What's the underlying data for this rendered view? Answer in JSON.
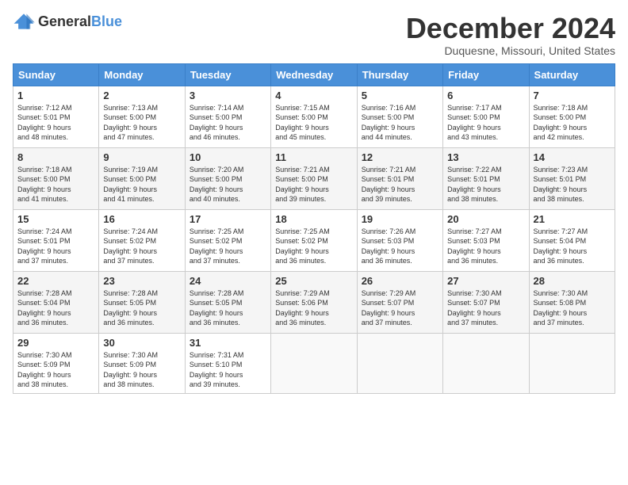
{
  "header": {
    "logo_general": "General",
    "logo_blue": "Blue",
    "month_title": "December 2024",
    "location": "Duquesne, Missouri, United States"
  },
  "weekdays": [
    "Sunday",
    "Monday",
    "Tuesday",
    "Wednesday",
    "Thursday",
    "Friday",
    "Saturday"
  ],
  "weeks": [
    [
      {
        "day": "1",
        "sunrise": "7:12 AM",
        "sunset": "5:01 PM",
        "daylight_hours": "9 hours",
        "daylight_mins": "48 minutes"
      },
      {
        "day": "2",
        "sunrise": "7:13 AM",
        "sunset": "5:00 PM",
        "daylight_hours": "9 hours",
        "daylight_mins": "47 minutes"
      },
      {
        "day": "3",
        "sunrise": "7:14 AM",
        "sunset": "5:00 PM",
        "daylight_hours": "9 hours",
        "daylight_mins": "46 minutes"
      },
      {
        "day": "4",
        "sunrise": "7:15 AM",
        "sunset": "5:00 PM",
        "daylight_hours": "9 hours",
        "daylight_mins": "45 minutes"
      },
      {
        "day": "5",
        "sunrise": "7:16 AM",
        "sunset": "5:00 PM",
        "daylight_hours": "9 hours",
        "daylight_mins": "44 minutes"
      },
      {
        "day": "6",
        "sunrise": "7:17 AM",
        "sunset": "5:00 PM",
        "daylight_hours": "9 hours",
        "daylight_mins": "43 minutes"
      },
      {
        "day": "7",
        "sunrise": "7:18 AM",
        "sunset": "5:00 PM",
        "daylight_hours": "9 hours",
        "daylight_mins": "42 minutes"
      }
    ],
    [
      {
        "day": "8",
        "sunrise": "7:18 AM",
        "sunset": "5:00 PM",
        "daylight_hours": "9 hours",
        "daylight_mins": "41 minutes"
      },
      {
        "day": "9",
        "sunrise": "7:19 AM",
        "sunset": "5:00 PM",
        "daylight_hours": "9 hours",
        "daylight_mins": "41 minutes"
      },
      {
        "day": "10",
        "sunrise": "7:20 AM",
        "sunset": "5:00 PM",
        "daylight_hours": "9 hours",
        "daylight_mins": "40 minutes"
      },
      {
        "day": "11",
        "sunrise": "7:21 AM",
        "sunset": "5:00 PM",
        "daylight_hours": "9 hours",
        "daylight_mins": "39 minutes"
      },
      {
        "day": "12",
        "sunrise": "7:21 AM",
        "sunset": "5:01 PM",
        "daylight_hours": "9 hours",
        "daylight_mins": "39 minutes"
      },
      {
        "day": "13",
        "sunrise": "7:22 AM",
        "sunset": "5:01 PM",
        "daylight_hours": "9 hours",
        "daylight_mins": "38 minutes"
      },
      {
        "day": "14",
        "sunrise": "7:23 AM",
        "sunset": "5:01 PM",
        "daylight_hours": "9 hours",
        "daylight_mins": "38 minutes"
      }
    ],
    [
      {
        "day": "15",
        "sunrise": "7:24 AM",
        "sunset": "5:01 PM",
        "daylight_hours": "9 hours",
        "daylight_mins": "37 minutes"
      },
      {
        "day": "16",
        "sunrise": "7:24 AM",
        "sunset": "5:02 PM",
        "daylight_hours": "9 hours",
        "daylight_mins": "37 minutes"
      },
      {
        "day": "17",
        "sunrise": "7:25 AM",
        "sunset": "5:02 PM",
        "daylight_hours": "9 hours",
        "daylight_mins": "37 minutes"
      },
      {
        "day": "18",
        "sunrise": "7:25 AM",
        "sunset": "5:02 PM",
        "daylight_hours": "9 hours",
        "daylight_mins": "36 minutes"
      },
      {
        "day": "19",
        "sunrise": "7:26 AM",
        "sunset": "5:03 PM",
        "daylight_hours": "9 hours",
        "daylight_mins": "36 minutes"
      },
      {
        "day": "20",
        "sunrise": "7:27 AM",
        "sunset": "5:03 PM",
        "daylight_hours": "9 hours",
        "daylight_mins": "36 minutes"
      },
      {
        "day": "21",
        "sunrise": "7:27 AM",
        "sunset": "5:04 PM",
        "daylight_hours": "9 hours",
        "daylight_mins": "36 minutes"
      }
    ],
    [
      {
        "day": "22",
        "sunrise": "7:28 AM",
        "sunset": "5:04 PM",
        "daylight_hours": "9 hours",
        "daylight_mins": "36 minutes"
      },
      {
        "day": "23",
        "sunrise": "7:28 AM",
        "sunset": "5:05 PM",
        "daylight_hours": "9 hours",
        "daylight_mins": "36 minutes"
      },
      {
        "day": "24",
        "sunrise": "7:28 AM",
        "sunset": "5:05 PM",
        "daylight_hours": "9 hours",
        "daylight_mins": "36 minutes"
      },
      {
        "day": "25",
        "sunrise": "7:29 AM",
        "sunset": "5:06 PM",
        "daylight_hours": "9 hours",
        "daylight_mins": "36 minutes"
      },
      {
        "day": "26",
        "sunrise": "7:29 AM",
        "sunset": "5:07 PM",
        "daylight_hours": "9 hours",
        "daylight_mins": "37 minutes"
      },
      {
        "day": "27",
        "sunrise": "7:30 AM",
        "sunset": "5:07 PM",
        "daylight_hours": "9 hours",
        "daylight_mins": "37 minutes"
      },
      {
        "day": "28",
        "sunrise": "7:30 AM",
        "sunset": "5:08 PM",
        "daylight_hours": "9 hours",
        "daylight_mins": "37 minutes"
      }
    ],
    [
      {
        "day": "29",
        "sunrise": "7:30 AM",
        "sunset": "5:09 PM",
        "daylight_hours": "9 hours",
        "daylight_mins": "38 minutes"
      },
      {
        "day": "30",
        "sunrise": "7:30 AM",
        "sunset": "5:09 PM",
        "daylight_hours": "9 hours",
        "daylight_mins": "38 minutes"
      },
      {
        "day": "31",
        "sunrise": "7:31 AM",
        "sunset": "5:10 PM",
        "daylight_hours": "9 hours",
        "daylight_mins": "39 minutes"
      },
      null,
      null,
      null,
      null
    ]
  ],
  "labels": {
    "sunrise": "Sunrise:",
    "sunset": "Sunset:",
    "daylight": "Daylight:"
  }
}
